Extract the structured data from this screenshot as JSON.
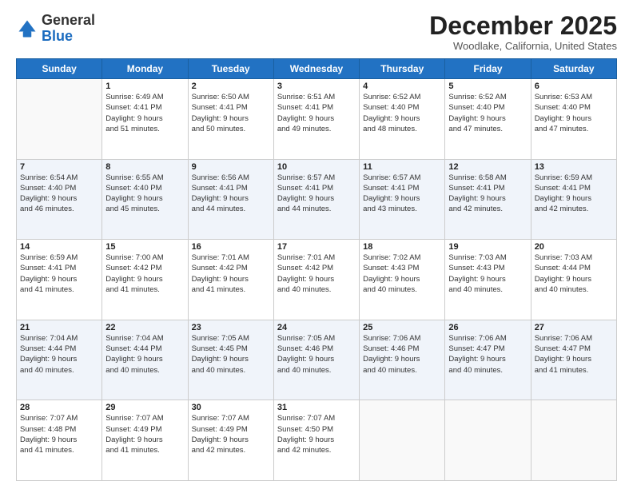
{
  "header": {
    "logo_general": "General",
    "logo_blue": "Blue",
    "month_title": "December 2025",
    "location": "Woodlake, California, United States"
  },
  "days_of_week": [
    "Sunday",
    "Monday",
    "Tuesday",
    "Wednesday",
    "Thursday",
    "Friday",
    "Saturday"
  ],
  "weeks": [
    {
      "alt": false,
      "days": [
        {
          "num": "",
          "empty": true,
          "info": ""
        },
        {
          "num": "1",
          "empty": false,
          "info": "Sunrise: 6:49 AM\nSunset: 4:41 PM\nDaylight: 9 hours\nand 51 minutes."
        },
        {
          "num": "2",
          "empty": false,
          "info": "Sunrise: 6:50 AM\nSunset: 4:41 PM\nDaylight: 9 hours\nand 50 minutes."
        },
        {
          "num": "3",
          "empty": false,
          "info": "Sunrise: 6:51 AM\nSunset: 4:41 PM\nDaylight: 9 hours\nand 49 minutes."
        },
        {
          "num": "4",
          "empty": false,
          "info": "Sunrise: 6:52 AM\nSunset: 4:40 PM\nDaylight: 9 hours\nand 48 minutes."
        },
        {
          "num": "5",
          "empty": false,
          "info": "Sunrise: 6:52 AM\nSunset: 4:40 PM\nDaylight: 9 hours\nand 47 minutes."
        },
        {
          "num": "6",
          "empty": false,
          "info": "Sunrise: 6:53 AM\nSunset: 4:40 PM\nDaylight: 9 hours\nand 47 minutes."
        }
      ]
    },
    {
      "alt": true,
      "days": [
        {
          "num": "7",
          "empty": false,
          "info": "Sunrise: 6:54 AM\nSunset: 4:40 PM\nDaylight: 9 hours\nand 46 minutes."
        },
        {
          "num": "8",
          "empty": false,
          "info": "Sunrise: 6:55 AM\nSunset: 4:40 PM\nDaylight: 9 hours\nand 45 minutes."
        },
        {
          "num": "9",
          "empty": false,
          "info": "Sunrise: 6:56 AM\nSunset: 4:41 PM\nDaylight: 9 hours\nand 44 minutes."
        },
        {
          "num": "10",
          "empty": false,
          "info": "Sunrise: 6:57 AM\nSunset: 4:41 PM\nDaylight: 9 hours\nand 44 minutes."
        },
        {
          "num": "11",
          "empty": false,
          "info": "Sunrise: 6:57 AM\nSunset: 4:41 PM\nDaylight: 9 hours\nand 43 minutes."
        },
        {
          "num": "12",
          "empty": false,
          "info": "Sunrise: 6:58 AM\nSunset: 4:41 PM\nDaylight: 9 hours\nand 42 minutes."
        },
        {
          "num": "13",
          "empty": false,
          "info": "Sunrise: 6:59 AM\nSunset: 4:41 PM\nDaylight: 9 hours\nand 42 minutes."
        }
      ]
    },
    {
      "alt": false,
      "days": [
        {
          "num": "14",
          "empty": false,
          "info": "Sunrise: 6:59 AM\nSunset: 4:41 PM\nDaylight: 9 hours\nand 41 minutes."
        },
        {
          "num": "15",
          "empty": false,
          "info": "Sunrise: 7:00 AM\nSunset: 4:42 PM\nDaylight: 9 hours\nand 41 minutes."
        },
        {
          "num": "16",
          "empty": false,
          "info": "Sunrise: 7:01 AM\nSunset: 4:42 PM\nDaylight: 9 hours\nand 41 minutes."
        },
        {
          "num": "17",
          "empty": false,
          "info": "Sunrise: 7:01 AM\nSunset: 4:42 PM\nDaylight: 9 hours\nand 40 minutes."
        },
        {
          "num": "18",
          "empty": false,
          "info": "Sunrise: 7:02 AM\nSunset: 4:43 PM\nDaylight: 9 hours\nand 40 minutes."
        },
        {
          "num": "19",
          "empty": false,
          "info": "Sunrise: 7:03 AM\nSunset: 4:43 PM\nDaylight: 9 hours\nand 40 minutes."
        },
        {
          "num": "20",
          "empty": false,
          "info": "Sunrise: 7:03 AM\nSunset: 4:44 PM\nDaylight: 9 hours\nand 40 minutes."
        }
      ]
    },
    {
      "alt": true,
      "days": [
        {
          "num": "21",
          "empty": false,
          "info": "Sunrise: 7:04 AM\nSunset: 4:44 PM\nDaylight: 9 hours\nand 40 minutes."
        },
        {
          "num": "22",
          "empty": false,
          "info": "Sunrise: 7:04 AM\nSunset: 4:44 PM\nDaylight: 9 hours\nand 40 minutes."
        },
        {
          "num": "23",
          "empty": false,
          "info": "Sunrise: 7:05 AM\nSunset: 4:45 PM\nDaylight: 9 hours\nand 40 minutes."
        },
        {
          "num": "24",
          "empty": false,
          "info": "Sunrise: 7:05 AM\nSunset: 4:46 PM\nDaylight: 9 hours\nand 40 minutes."
        },
        {
          "num": "25",
          "empty": false,
          "info": "Sunrise: 7:06 AM\nSunset: 4:46 PM\nDaylight: 9 hours\nand 40 minutes."
        },
        {
          "num": "26",
          "empty": false,
          "info": "Sunrise: 7:06 AM\nSunset: 4:47 PM\nDaylight: 9 hours\nand 40 minutes."
        },
        {
          "num": "27",
          "empty": false,
          "info": "Sunrise: 7:06 AM\nSunset: 4:47 PM\nDaylight: 9 hours\nand 41 minutes."
        }
      ]
    },
    {
      "alt": false,
      "days": [
        {
          "num": "28",
          "empty": false,
          "info": "Sunrise: 7:07 AM\nSunset: 4:48 PM\nDaylight: 9 hours\nand 41 minutes."
        },
        {
          "num": "29",
          "empty": false,
          "info": "Sunrise: 7:07 AM\nSunset: 4:49 PM\nDaylight: 9 hours\nand 41 minutes."
        },
        {
          "num": "30",
          "empty": false,
          "info": "Sunrise: 7:07 AM\nSunset: 4:49 PM\nDaylight: 9 hours\nand 42 minutes."
        },
        {
          "num": "31",
          "empty": false,
          "info": "Sunrise: 7:07 AM\nSunset: 4:50 PM\nDaylight: 9 hours\nand 42 minutes."
        },
        {
          "num": "",
          "empty": true,
          "info": ""
        },
        {
          "num": "",
          "empty": true,
          "info": ""
        },
        {
          "num": "",
          "empty": true,
          "info": ""
        }
      ]
    }
  ]
}
